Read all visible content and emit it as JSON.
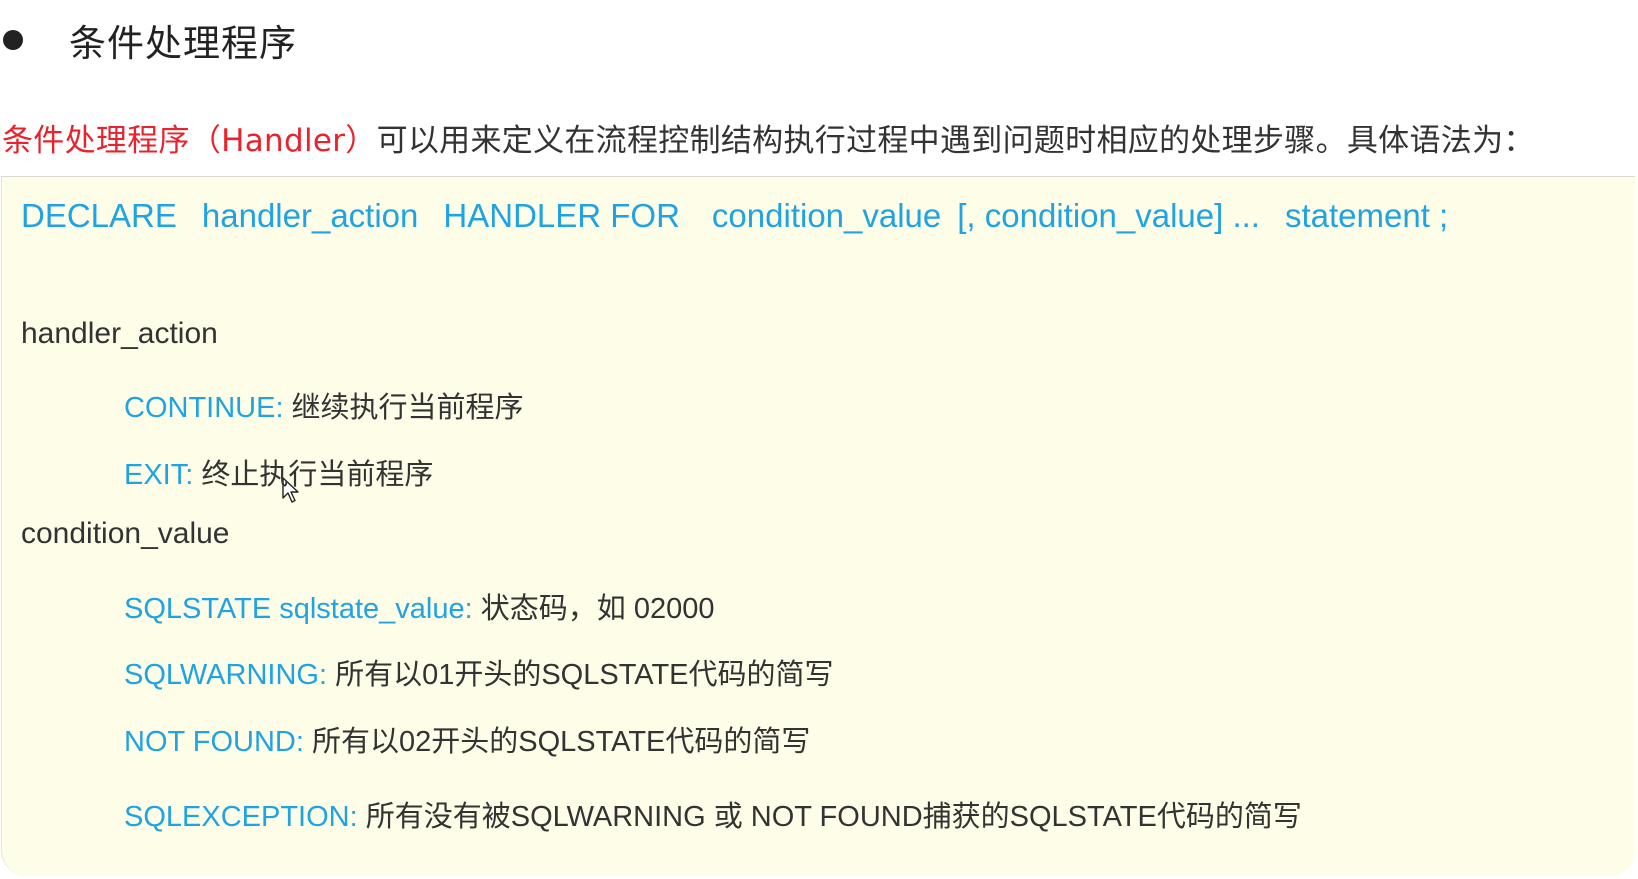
{
  "heading": {
    "title": "条件处理程序"
  },
  "intro": {
    "term": "条件处理程序",
    "handler": "（Handler）",
    "rest": "可以用来定义在流程控制结构执行过程中遇到问题时相应的处理步骤。具体语法为："
  },
  "syntax": {
    "declare": "DECLARE",
    "handler_action": "handler_action",
    "handler_for": "HANDLER FOR",
    "condition_value": "condition_value",
    "more_condition_values": "[, condition_value] ...",
    "statement": "statement ;"
  },
  "handler_action": {
    "label": "handler_action",
    "items": [
      {
        "key": "CONTINUE:",
        "desc": " 继续执行当前程序"
      },
      {
        "key": "EXIT:",
        "desc": " 终止执行当前程序"
      }
    ]
  },
  "condition_value": {
    "label": "condition_value",
    "items": [
      {
        "key": "SQLSTATE  sqlstate_value:",
        "desc": " 状态码，如 02000"
      },
      {
        "key": "SQLWARNING:",
        "desc": " 所有以01开头的SQLSTATE代码的简写"
      },
      {
        "key": "NOT FOUND:",
        "desc": " 所有以02开头的SQLSTATE代码的简写"
      },
      {
        "key": "SQLEXCEPTION:",
        "desc": " 所有没有被SQLWARNING 或 NOT FOUND捕获的SQLSTATE代码的简写"
      }
    ]
  },
  "colors": {
    "keyword": "#1fa3e3",
    "term": "#e8232e",
    "box_background": "#fefde8",
    "text": "#333333"
  },
  "icons": {
    "cursor": "mouse-pointer-icon",
    "bullet": "bullet-dot-icon"
  }
}
